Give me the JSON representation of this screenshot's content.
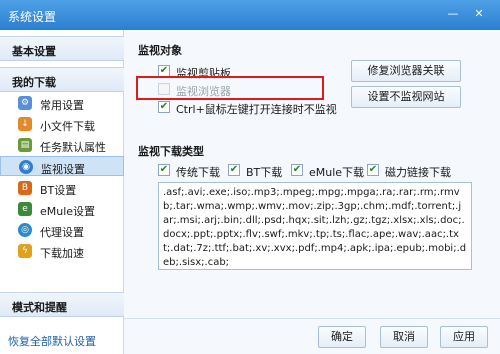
{
  "window": {
    "title": "系统设置",
    "minimize_label": "—",
    "close_label": "✕"
  },
  "sidebar": {
    "sections": [
      {
        "label": "基本设置"
      },
      {
        "label": "我的下载"
      },
      {
        "label": "模式和提醒"
      }
    ],
    "items": [
      {
        "label": "常用设置",
        "icon": "gear-icon",
        "color": "#5a8fd8"
      },
      {
        "label": "小文件下载",
        "icon": "small-file-icon",
        "color": "#e08a2a"
      },
      {
        "label": "任务默认属性",
        "icon": "task-icon",
        "color": "#6a9a3a"
      },
      {
        "label": "监视设置",
        "icon": "monitor-icon",
        "color": "#2f7fd6"
      },
      {
        "label": "BT设置",
        "icon": "bt-icon",
        "color": "#d46a1a"
      },
      {
        "label": "eMule设置",
        "icon": "emule-icon",
        "color": "#3a8a3a"
      },
      {
        "label": "代理设置",
        "icon": "proxy-icon",
        "color": "#2a8bc8"
      },
      {
        "label": "下载加速",
        "icon": "accelerate-icon",
        "color": "#e0a020"
      }
    ],
    "active_item": "监视设置",
    "restore_link": "恢复全部默认设置"
  },
  "monitor": {
    "section_title": "监视对象",
    "options": [
      {
        "label": "监视剪贴板",
        "checked": true,
        "enabled": true
      },
      {
        "label": "监视浏览器",
        "checked": false,
        "enabled": false
      },
      {
        "label": "Ctrl+鼠标左键打开连接时不监视",
        "checked": true,
        "enabled": true
      }
    ],
    "buttons": {
      "repair": "修复浏览器关联",
      "exclude_sites": "设置不监视网站"
    }
  },
  "download_types": {
    "section_title": "监视下载类型",
    "types": [
      {
        "label": "传统下载",
        "checked": true
      },
      {
        "label": "BT下载",
        "checked": true
      },
      {
        "label": "eMule下载",
        "checked": true
      },
      {
        "label": "磁力链接下载",
        "checked": true
      }
    ],
    "extensions": ".asf;.avi;.exe;.iso;.mp3;.mpeg;.mpg;.mpga;.ra;.rar;.rm;.rmvb;.tar;.wma;.wmp;.wmv;.mov;.zip;.3gp;.chm;.mdf;.torrent;.jar;.msi;.arj;.bin;.dll;.psd;.hqx;.sit;.lzh;.gz;.tgz;.xlsx;.xls;.doc;.docx;.ppt;.pptx;.flv;.swf;.mkv;.tp;.ts;.flac;.ape;.wav;.aac;.txt;.dat;.7z;.ttf;.bat;.xv;.xvx;.pdf;.mp4;.apk;.ipa;.epub;.mobi;.deb;.sisx;.cab;"
  },
  "footer": {
    "ok": "确定",
    "cancel": "取消",
    "apply": "应用"
  }
}
